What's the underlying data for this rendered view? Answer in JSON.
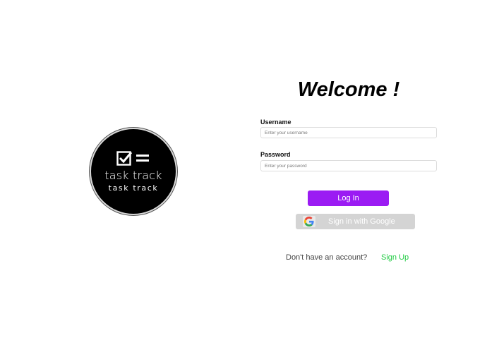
{
  "logo": {
    "line1": "task track",
    "line2": "task track"
  },
  "welcome": {
    "title": "Welcome !"
  },
  "form": {
    "username_label": "Username",
    "username_placeholder": "Enter your username",
    "password_label": "Password",
    "password_placeholder": "Enter your password",
    "login_label": "Log In",
    "google_label": "Sign in with Google"
  },
  "signup": {
    "prompt": "Don't have an account?",
    "link": "Sign Up"
  },
  "colors": {
    "login_button": "#9b1bf3",
    "google_button": "#d4d4d4",
    "signup_link": "#22cc44",
    "logo_background": "#000000"
  },
  "icons": {
    "logo_mark": "checklist-icon",
    "google": "google-icon"
  }
}
